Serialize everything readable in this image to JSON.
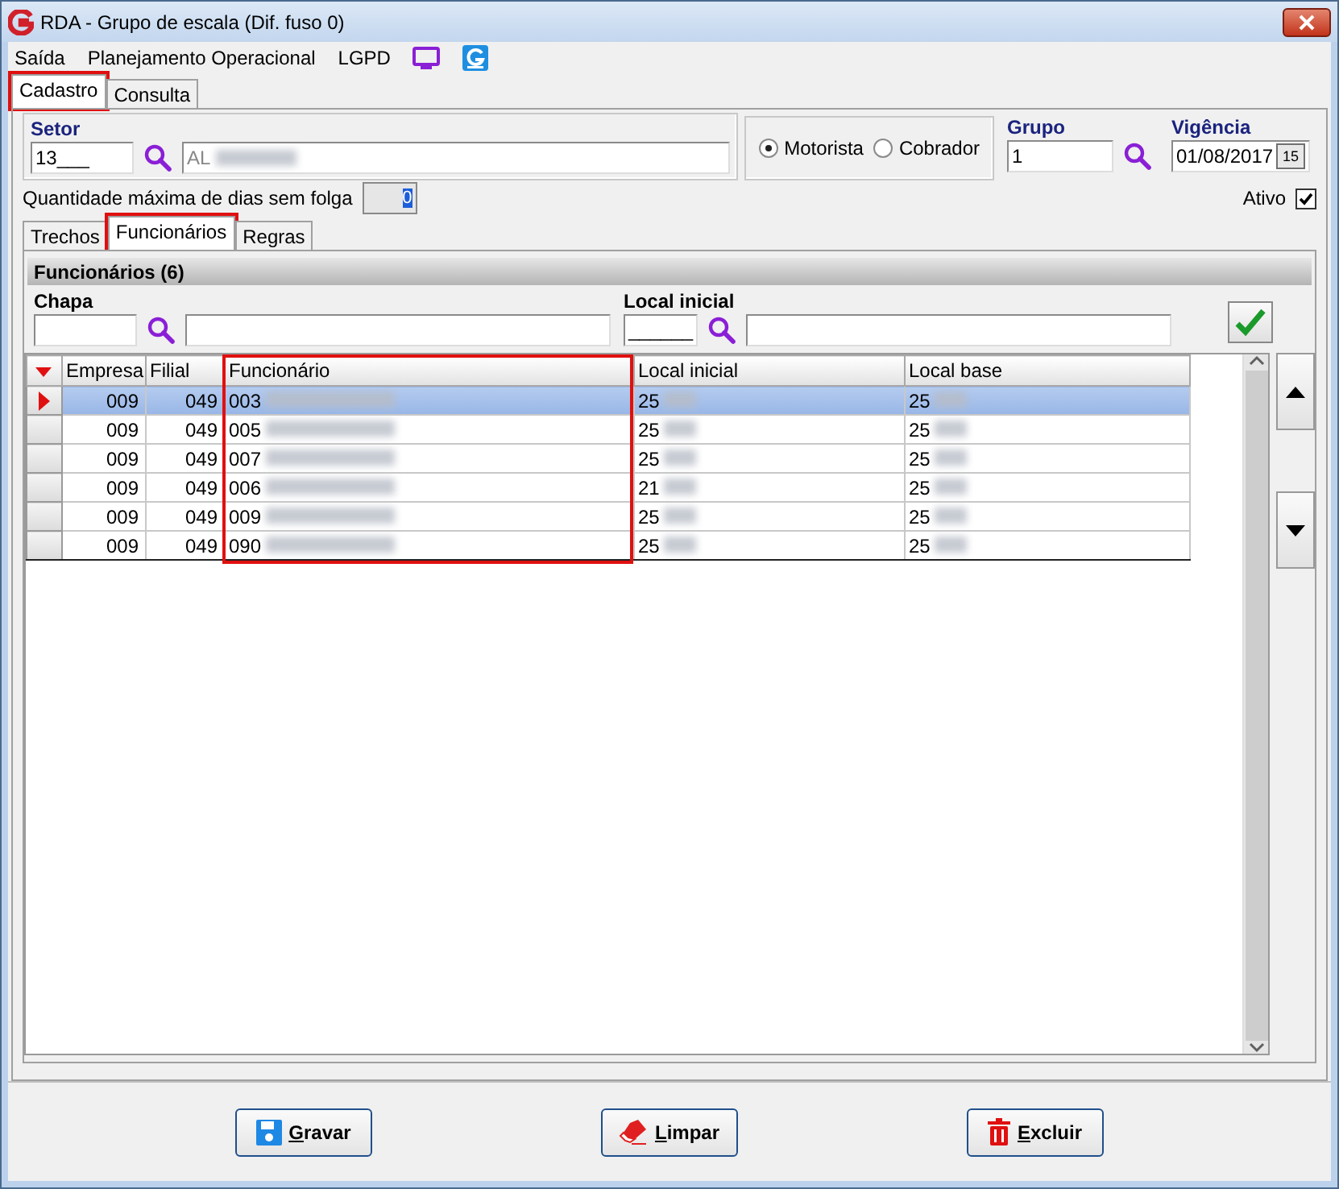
{
  "window": {
    "title": "RDA - Grupo de escala (Dif. fuso 0)"
  },
  "menu": [
    "Saída",
    "Planejamento Operacional",
    "LGPD"
  ],
  "tabs": [
    {
      "label": "Cadastro",
      "selected": true,
      "highlighted": true
    },
    {
      "label": "Consulta",
      "selected": false,
      "highlighted": false
    }
  ],
  "setor": {
    "label": "Setor",
    "code": "13___",
    "name": "AL",
    "redacted": true
  },
  "role": [
    {
      "label": "Motorista",
      "selected": true
    },
    {
      "label": "Cobrador",
      "selected": false
    }
  ],
  "grupo": {
    "label": "Grupo",
    "value": "1"
  },
  "vigencia": {
    "label": "Vigência",
    "value": "01/08/2017",
    "button": "15"
  },
  "max_days": {
    "label": "Quantidade máxima de dias sem folga",
    "value": "0"
  },
  "ativo": {
    "label": "Ativo",
    "checked": true
  },
  "subtabs": [
    {
      "label": "Trechos",
      "selected": false,
      "highlighted": false
    },
    {
      "label": "Funcionários",
      "selected": true,
      "highlighted": true
    },
    {
      "label": "Regras",
      "selected": false,
      "highlighted": false
    }
  ],
  "section": {
    "title": "Funcionários (6)"
  },
  "filters": {
    "chapa": {
      "label": "Chapa"
    },
    "local": {
      "label": "Local inicial",
      "code": "______"
    }
  },
  "table": {
    "columns": [
      {
        "label": "Empresa",
        "kind": "number",
        "highlighted": false
      },
      {
        "label": "Filial",
        "kind": "number",
        "highlighted": false
      },
      {
        "label": "Funcionário",
        "kind": "text",
        "highlighted": true
      },
      {
        "label": "Local inicial",
        "kind": "text",
        "highlighted": false
      },
      {
        "label": "Local base",
        "kind": "text",
        "highlighted": false
      }
    ],
    "rows": [
      {
        "selected": true,
        "cells": [
          "009",
          "049",
          "003",
          "25",
          "25"
        ]
      },
      {
        "selected": false,
        "cells": [
          "009",
          "049",
          "005",
          "25",
          "25"
        ]
      },
      {
        "selected": false,
        "cells": [
          "009",
          "049",
          "007",
          "25",
          "25"
        ]
      },
      {
        "selected": false,
        "cells": [
          "009",
          "049",
          "006",
          "21",
          "25"
        ]
      },
      {
        "selected": false,
        "cells": [
          "009",
          "049",
          "009",
          "25",
          "25"
        ]
      },
      {
        "selected": false,
        "cells": [
          "009",
          "049",
          "090",
          "25",
          "25"
        ]
      }
    ]
  },
  "buttons": [
    {
      "label": "Gravar",
      "kind": "save"
    },
    {
      "label": "Limpar",
      "kind": "clear"
    },
    {
      "label": "Excluir",
      "kind": "delete"
    }
  ]
}
